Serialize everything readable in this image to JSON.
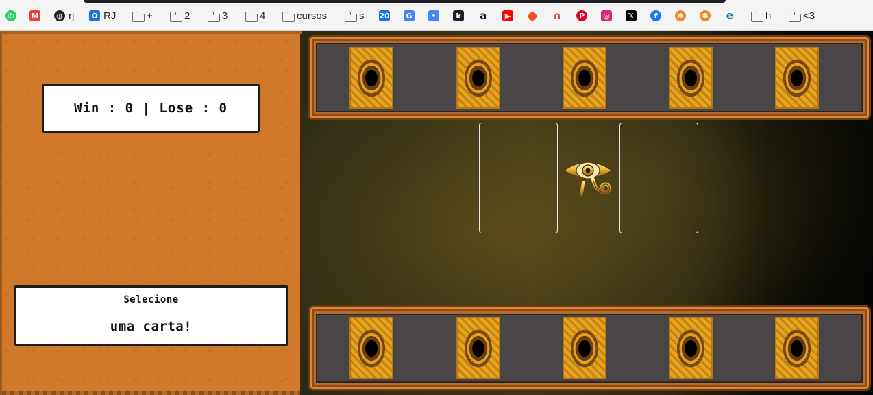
{
  "bookmarks": [
    {
      "label": "",
      "icon": "whatsapp-icon",
      "color": "#25d366",
      "glyph": "✆"
    },
    {
      "label": "",
      "icon": "gmail-icon",
      "color": "#ea4335",
      "glyph": "M"
    },
    {
      "label": "rj",
      "icon": "globe-icon",
      "color": "#202124",
      "glyph": "◍"
    },
    {
      "label": "RJ",
      "icon": "app-icon",
      "color": "#1a73e8",
      "glyph": "O"
    },
    {
      "label": "+",
      "icon": "folder-icon"
    },
    {
      "label": "2",
      "icon": "folder-icon"
    },
    {
      "label": "3",
      "icon": "folder-icon"
    },
    {
      "label": "4",
      "icon": "folder-icon"
    },
    {
      "label": "cursos",
      "icon": "folder-icon"
    },
    {
      "label": "s",
      "icon": "folder-icon"
    },
    {
      "label": "",
      "icon": "calendar-icon",
      "color": "#1a73e8",
      "glyph": "20"
    },
    {
      "label": "",
      "icon": "translate-icon",
      "color": "#4285f4",
      "glyph": "G"
    },
    {
      "label": "",
      "icon": "assistant-icon",
      "color": "#4285f4",
      "glyph": "•"
    },
    {
      "label": "",
      "icon": "tool-icon",
      "color": "#202124",
      "glyph": "k"
    },
    {
      "label": "",
      "icon": "amazon-icon",
      "color": "#111111",
      "glyph": "a"
    },
    {
      "label": "",
      "icon": "youtube-icon",
      "color": "#ff0000",
      "glyph": "▶"
    },
    {
      "label": "",
      "icon": "orange-circle-icon",
      "color": "#f4511e",
      "glyph": "●"
    },
    {
      "label": "",
      "icon": "headphones-icon",
      "color": "#e53935",
      "glyph": "∩"
    },
    {
      "label": "",
      "icon": "pinterest-icon",
      "color": "#e60023",
      "glyph": "P"
    },
    {
      "label": "",
      "icon": "instagram-icon",
      "color": "#d62976",
      "glyph": "◎"
    },
    {
      "label": "",
      "icon": "x-icon",
      "color": "#000000",
      "glyph": "𝕏"
    },
    {
      "label": "",
      "icon": "facebook-icon",
      "color": "#1877f2",
      "glyph": "f"
    },
    {
      "label": "",
      "icon": "badge-icon",
      "color": "#f08a24",
      "glyph": "✱"
    },
    {
      "label": "",
      "icon": "badge-icon",
      "color": "#f08a24",
      "glyph": "✱"
    },
    {
      "label": "",
      "icon": "edge-icon",
      "color": "#0f7bbd",
      "glyph": "e"
    },
    {
      "label": "h",
      "icon": "folder-icon"
    },
    {
      "label": "<3",
      "icon": "folder-icon"
    }
  ],
  "score": {
    "text": "Win : 0 | Lose : 0"
  },
  "message": {
    "title": "Selecione",
    "subtitle": "uma carta!"
  },
  "computer_hand": {
    "count": 5,
    "card": "card-back"
  },
  "player_hand": {
    "count": 5,
    "card": "card-back"
  },
  "colors": {
    "panel": "#d0792b",
    "card": "#e8a31c",
    "frame": "#b86a2a"
  }
}
